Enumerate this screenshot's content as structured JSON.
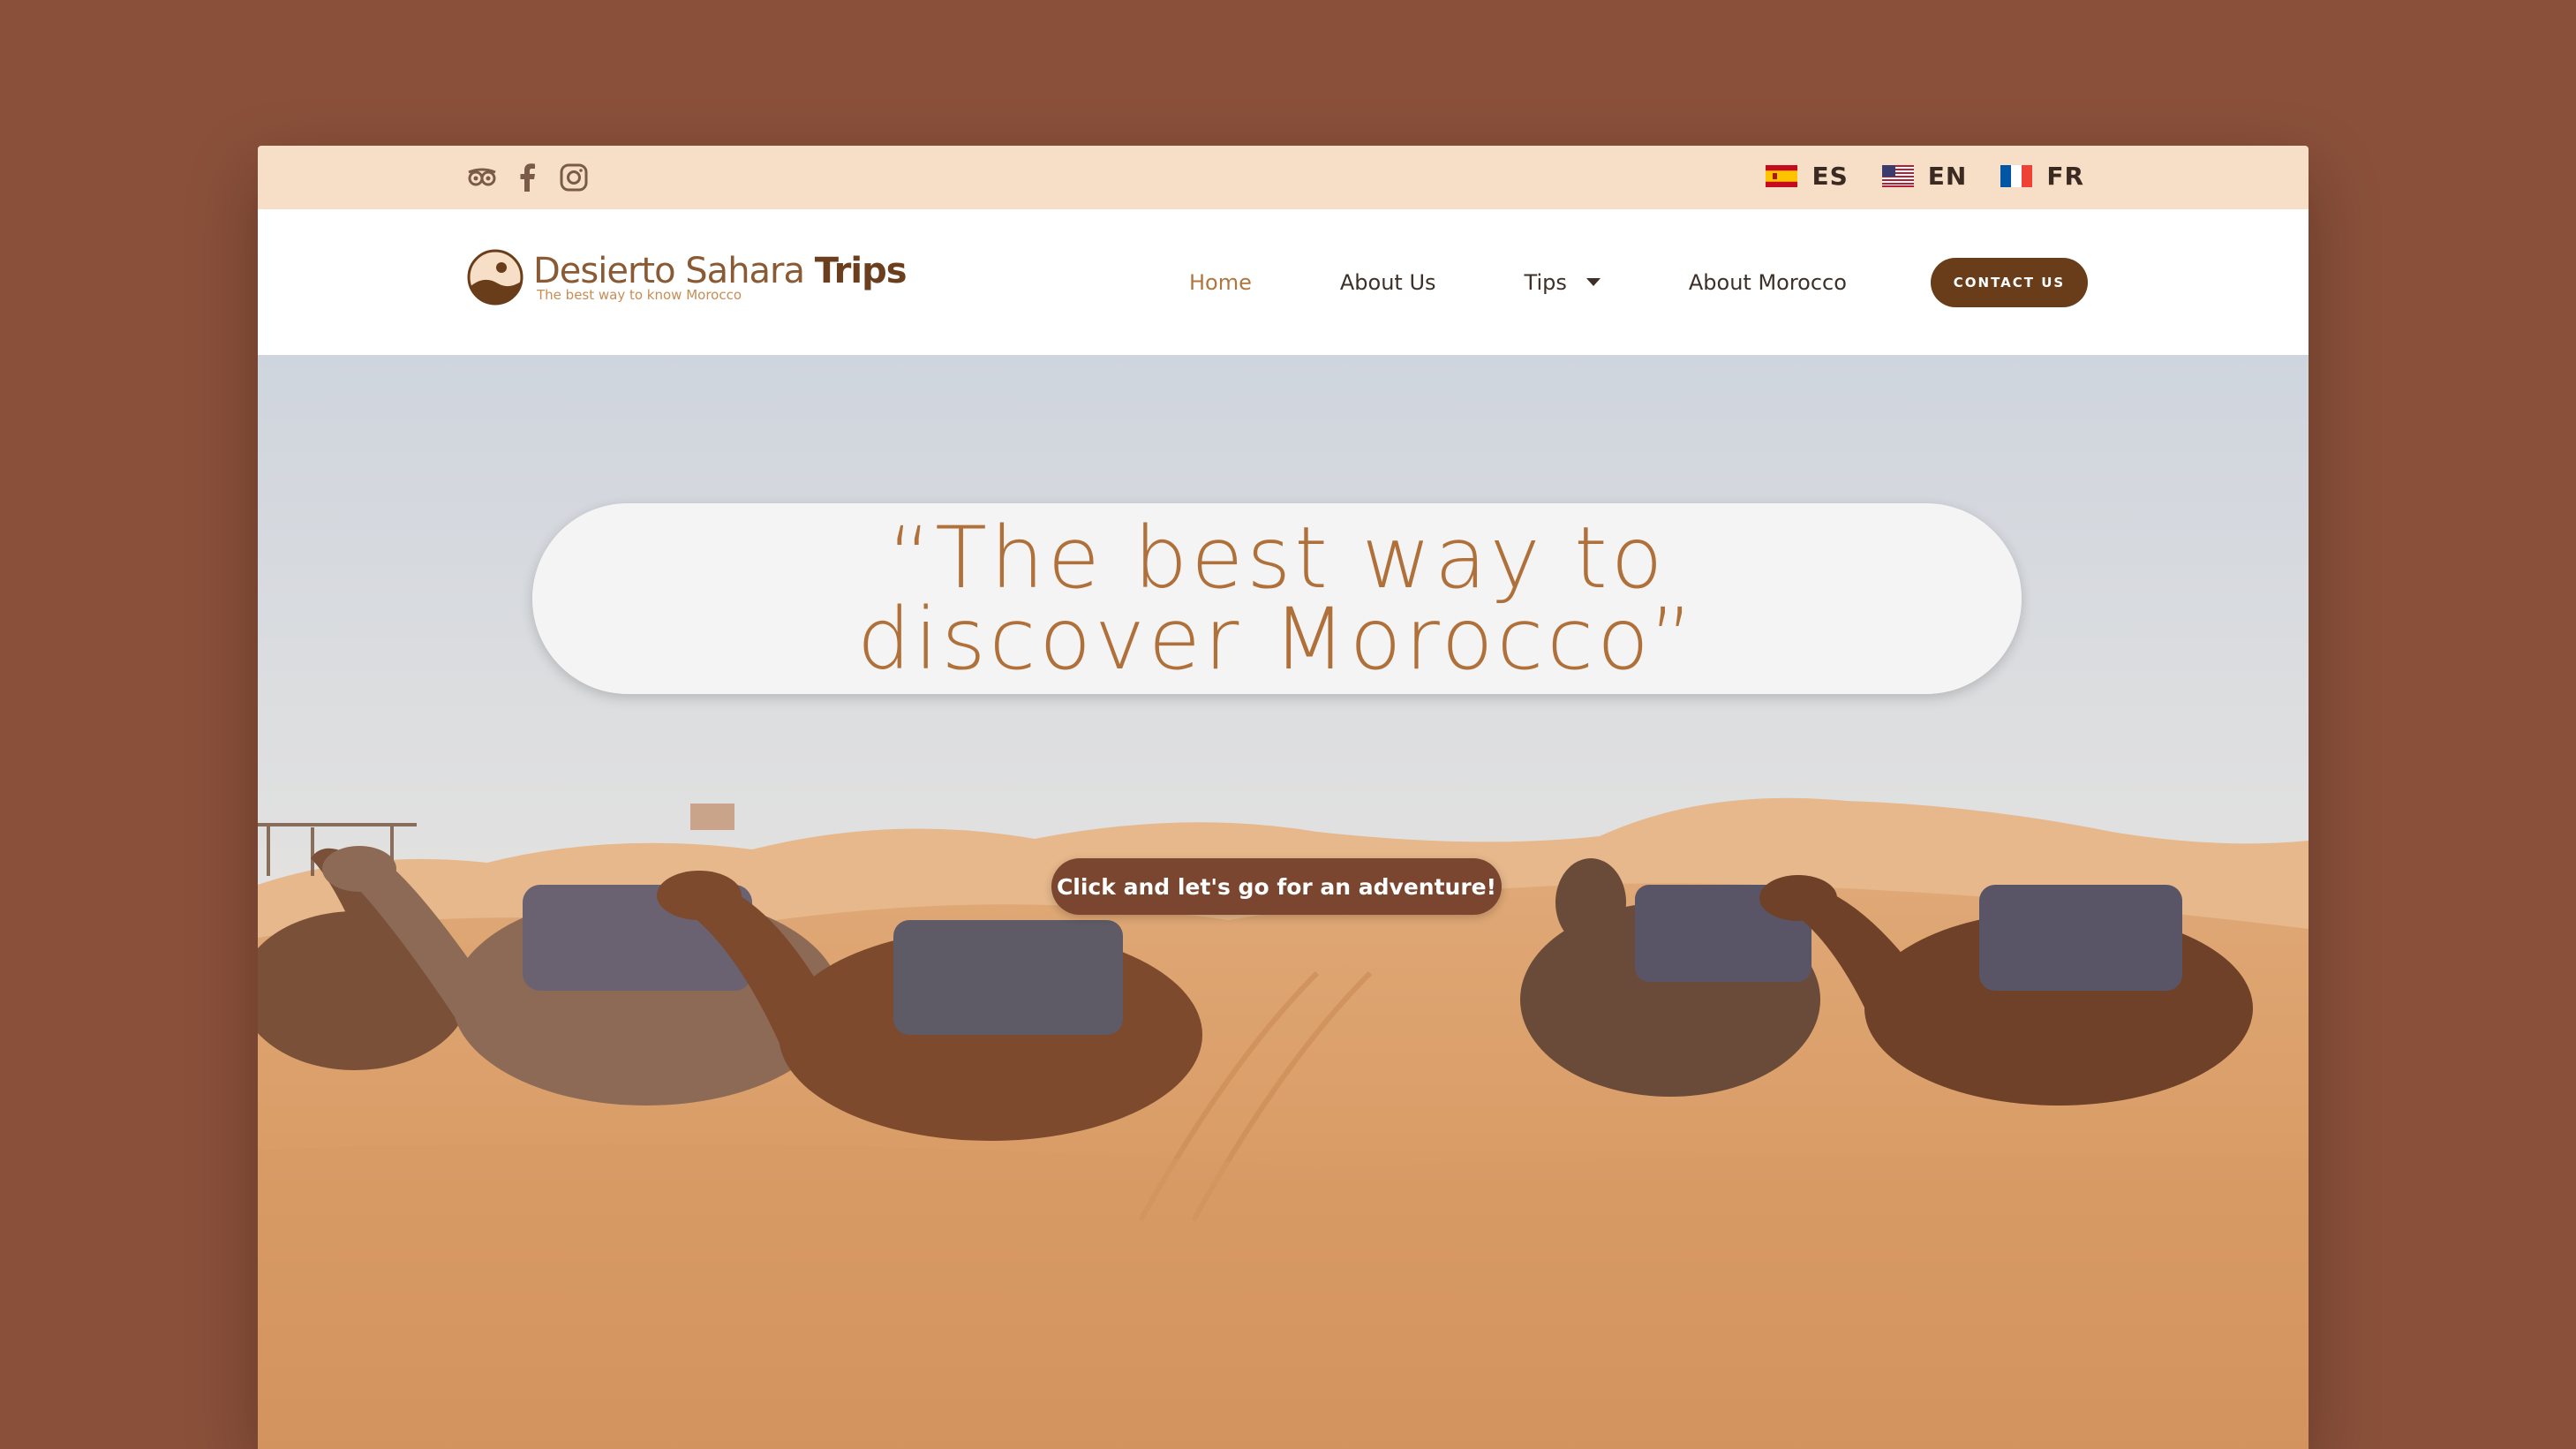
{
  "colors": {
    "background": "#8a503a",
    "topbar": "#f7dfc7",
    "brand_dark": "#6a3d1a",
    "brand_accent": "#b0703a",
    "cta": "#7a4630"
  },
  "social_icons": [
    "tripadvisor-icon",
    "facebook-icon",
    "instagram-icon"
  ],
  "languages": [
    {
      "code": "ES",
      "flag": "spain-flag-icon"
    },
    {
      "code": "EN",
      "flag": "usa-flag-icon"
    },
    {
      "code": "FR",
      "flag": "france-flag-icon"
    }
  ],
  "logo": {
    "name_regular": "Desierto Sahara",
    "name_bold": "Trips",
    "tagline": "The best way to know Morocco"
  },
  "nav": {
    "items": [
      {
        "label": "Home",
        "active": true
      },
      {
        "label": "About Us",
        "active": false
      },
      {
        "label": "Tips",
        "active": false,
        "dropdown": true
      },
      {
        "label": "About Morocco",
        "active": false
      }
    ],
    "contact_label": "CONTACT US"
  },
  "hero": {
    "quote": "“The best way to discover Morocco”",
    "cta_label": "Click and let's go for an adventure!"
  }
}
